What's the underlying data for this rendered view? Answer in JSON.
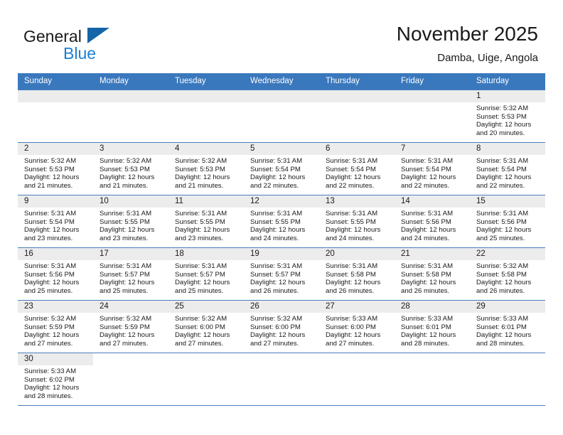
{
  "brand": {
    "name_part1": "General",
    "name_part2": "Blue",
    "flag_icon": "blue-triangle-flag"
  },
  "header": {
    "title": "November 2025",
    "subtitle": "Damba, Uige, Angola"
  },
  "colors": {
    "header_blue": "#3a78bd",
    "row_separator_blue": "#4a7ebb",
    "daynum_band_gray": "#ececec",
    "brand_blue": "#1b7fd4",
    "flag_blue": "#1565a8"
  },
  "weekday_headers": [
    "Sunday",
    "Monday",
    "Tuesday",
    "Wednesday",
    "Thursday",
    "Friday",
    "Saturday"
  ],
  "weeks": [
    [
      {
        "empty": true
      },
      {
        "empty": true
      },
      {
        "empty": true
      },
      {
        "empty": true
      },
      {
        "empty": true
      },
      {
        "empty": true
      },
      {
        "day": "1",
        "sunrise": "Sunrise: 5:32 AM",
        "sunset": "Sunset: 5:53 PM",
        "daylight_line1": "Daylight: 12 hours",
        "daylight_line2": "and 20 minutes."
      }
    ],
    [
      {
        "day": "2",
        "sunrise": "Sunrise: 5:32 AM",
        "sunset": "Sunset: 5:53 PM",
        "daylight_line1": "Daylight: 12 hours",
        "daylight_line2": "and 21 minutes."
      },
      {
        "day": "3",
        "sunrise": "Sunrise: 5:32 AM",
        "sunset": "Sunset: 5:53 PM",
        "daylight_line1": "Daylight: 12 hours",
        "daylight_line2": "and 21 minutes."
      },
      {
        "day": "4",
        "sunrise": "Sunrise: 5:32 AM",
        "sunset": "Sunset: 5:53 PM",
        "daylight_line1": "Daylight: 12 hours",
        "daylight_line2": "and 21 minutes."
      },
      {
        "day": "5",
        "sunrise": "Sunrise: 5:31 AM",
        "sunset": "Sunset: 5:54 PM",
        "daylight_line1": "Daylight: 12 hours",
        "daylight_line2": "and 22 minutes."
      },
      {
        "day": "6",
        "sunrise": "Sunrise: 5:31 AM",
        "sunset": "Sunset: 5:54 PM",
        "daylight_line1": "Daylight: 12 hours",
        "daylight_line2": "and 22 minutes."
      },
      {
        "day": "7",
        "sunrise": "Sunrise: 5:31 AM",
        "sunset": "Sunset: 5:54 PM",
        "daylight_line1": "Daylight: 12 hours",
        "daylight_line2": "and 22 minutes."
      },
      {
        "day": "8",
        "sunrise": "Sunrise: 5:31 AM",
        "sunset": "Sunset: 5:54 PM",
        "daylight_line1": "Daylight: 12 hours",
        "daylight_line2": "and 22 minutes."
      }
    ],
    [
      {
        "day": "9",
        "sunrise": "Sunrise: 5:31 AM",
        "sunset": "Sunset: 5:54 PM",
        "daylight_line1": "Daylight: 12 hours",
        "daylight_line2": "and 23 minutes."
      },
      {
        "day": "10",
        "sunrise": "Sunrise: 5:31 AM",
        "sunset": "Sunset: 5:55 PM",
        "daylight_line1": "Daylight: 12 hours",
        "daylight_line2": "and 23 minutes."
      },
      {
        "day": "11",
        "sunrise": "Sunrise: 5:31 AM",
        "sunset": "Sunset: 5:55 PM",
        "daylight_line1": "Daylight: 12 hours",
        "daylight_line2": "and 23 minutes."
      },
      {
        "day": "12",
        "sunrise": "Sunrise: 5:31 AM",
        "sunset": "Sunset: 5:55 PM",
        "daylight_line1": "Daylight: 12 hours",
        "daylight_line2": "and 24 minutes."
      },
      {
        "day": "13",
        "sunrise": "Sunrise: 5:31 AM",
        "sunset": "Sunset: 5:55 PM",
        "daylight_line1": "Daylight: 12 hours",
        "daylight_line2": "and 24 minutes."
      },
      {
        "day": "14",
        "sunrise": "Sunrise: 5:31 AM",
        "sunset": "Sunset: 5:56 PM",
        "daylight_line1": "Daylight: 12 hours",
        "daylight_line2": "and 24 minutes."
      },
      {
        "day": "15",
        "sunrise": "Sunrise: 5:31 AM",
        "sunset": "Sunset: 5:56 PM",
        "daylight_line1": "Daylight: 12 hours",
        "daylight_line2": "and 25 minutes."
      }
    ],
    [
      {
        "day": "16",
        "sunrise": "Sunrise: 5:31 AM",
        "sunset": "Sunset: 5:56 PM",
        "daylight_line1": "Daylight: 12 hours",
        "daylight_line2": "and 25 minutes."
      },
      {
        "day": "17",
        "sunrise": "Sunrise: 5:31 AM",
        "sunset": "Sunset: 5:57 PM",
        "daylight_line1": "Daylight: 12 hours",
        "daylight_line2": "and 25 minutes."
      },
      {
        "day": "18",
        "sunrise": "Sunrise: 5:31 AM",
        "sunset": "Sunset: 5:57 PM",
        "daylight_line1": "Daylight: 12 hours",
        "daylight_line2": "and 25 minutes."
      },
      {
        "day": "19",
        "sunrise": "Sunrise: 5:31 AM",
        "sunset": "Sunset: 5:57 PM",
        "daylight_line1": "Daylight: 12 hours",
        "daylight_line2": "and 26 minutes."
      },
      {
        "day": "20",
        "sunrise": "Sunrise: 5:31 AM",
        "sunset": "Sunset: 5:58 PM",
        "daylight_line1": "Daylight: 12 hours",
        "daylight_line2": "and 26 minutes."
      },
      {
        "day": "21",
        "sunrise": "Sunrise: 5:31 AM",
        "sunset": "Sunset: 5:58 PM",
        "daylight_line1": "Daylight: 12 hours",
        "daylight_line2": "and 26 minutes."
      },
      {
        "day": "22",
        "sunrise": "Sunrise: 5:32 AM",
        "sunset": "Sunset: 5:58 PM",
        "daylight_line1": "Daylight: 12 hours",
        "daylight_line2": "and 26 minutes."
      }
    ],
    [
      {
        "day": "23",
        "sunrise": "Sunrise: 5:32 AM",
        "sunset": "Sunset: 5:59 PM",
        "daylight_line1": "Daylight: 12 hours",
        "daylight_line2": "and 27 minutes."
      },
      {
        "day": "24",
        "sunrise": "Sunrise: 5:32 AM",
        "sunset": "Sunset: 5:59 PM",
        "daylight_line1": "Daylight: 12 hours",
        "daylight_line2": "and 27 minutes."
      },
      {
        "day": "25",
        "sunrise": "Sunrise: 5:32 AM",
        "sunset": "Sunset: 6:00 PM",
        "daylight_line1": "Daylight: 12 hours",
        "daylight_line2": "and 27 minutes."
      },
      {
        "day": "26",
        "sunrise": "Sunrise: 5:32 AM",
        "sunset": "Sunset: 6:00 PM",
        "daylight_line1": "Daylight: 12 hours",
        "daylight_line2": "and 27 minutes."
      },
      {
        "day": "27",
        "sunrise": "Sunrise: 5:33 AM",
        "sunset": "Sunset: 6:00 PM",
        "daylight_line1": "Daylight: 12 hours",
        "daylight_line2": "and 27 minutes."
      },
      {
        "day": "28",
        "sunrise": "Sunrise: 5:33 AM",
        "sunset": "Sunset: 6:01 PM",
        "daylight_line1": "Daylight: 12 hours",
        "daylight_line2": "and 28 minutes."
      },
      {
        "day": "29",
        "sunrise": "Sunrise: 5:33 AM",
        "sunset": "Sunset: 6:01 PM",
        "daylight_line1": "Daylight: 12 hours",
        "daylight_line2": "and 28 minutes."
      }
    ],
    [
      {
        "day": "30",
        "sunrise": "Sunrise: 5:33 AM",
        "sunset": "Sunset: 6:02 PM",
        "daylight_line1": "Daylight: 12 hours",
        "daylight_line2": "and 28 minutes."
      },
      {
        "blank": true
      },
      {
        "blank": true
      },
      {
        "blank": true
      },
      {
        "blank": true
      },
      {
        "blank": true
      },
      {
        "blank": true
      }
    ]
  ]
}
